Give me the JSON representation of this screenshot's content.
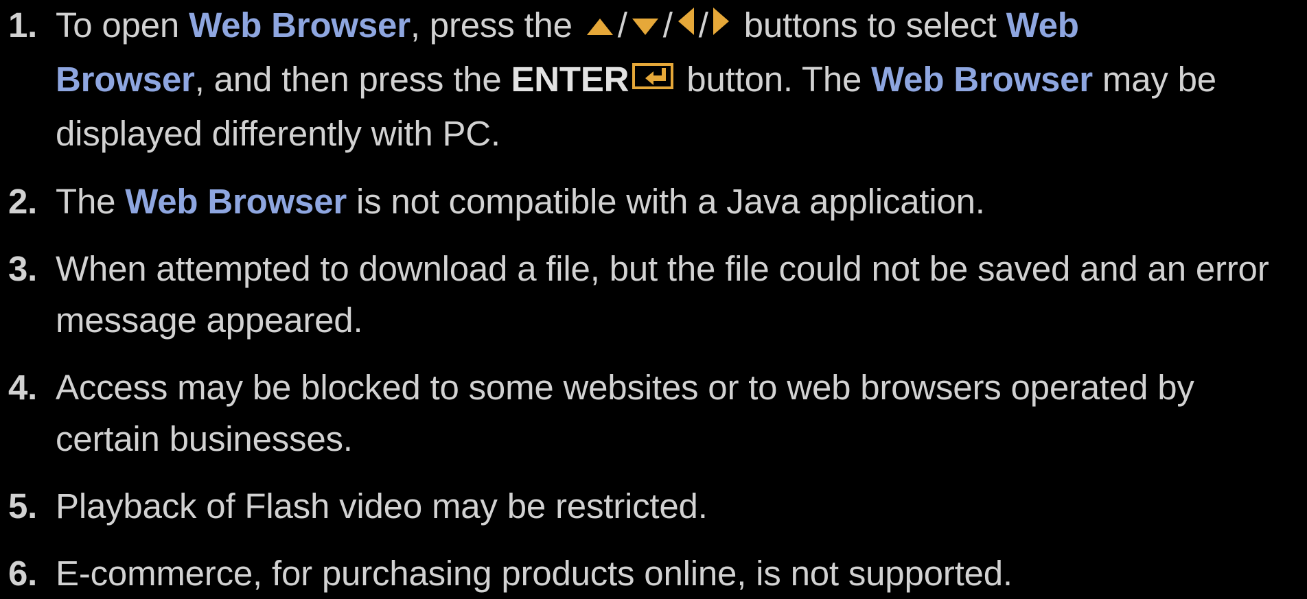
{
  "colors": {
    "background": "#000000",
    "text": "#d2d2d2",
    "highlight": "#8ea6e0",
    "icon": "#e6a839"
  },
  "items": [
    {
      "number": "1.",
      "lines": [
        {
          "segments": {
            "a": "To open ",
            "b": "Web Browser",
            "c": ", press the ",
            "sep1": "/",
            "sep2": "/",
            "sep3": "/",
            "d": " buttons to select ",
            "e": "Web"
          }
        },
        {
          "segments": {
            "a": "Browser",
            "b": ", and then press the ",
            "c": "ENTER",
            "d": " button. The ",
            "e": "Web Browser",
            "f": " may be"
          }
        },
        {
          "text": "displayed differently with PC."
        }
      ],
      "icons": [
        "up-arrow-icon",
        "down-arrow-icon",
        "left-arrow-icon",
        "right-arrow-icon",
        "enter-icon"
      ]
    },
    {
      "number": "2.",
      "segments": {
        "a": "The ",
        "b": "Web Browser",
        "c": " is not compatible with a Java application."
      }
    },
    {
      "number": "3.",
      "lines": [
        {
          "text": "When attempted to download a file, but the file could not be saved and an error"
        },
        {
          "text": "message appeared."
        }
      ]
    },
    {
      "number": "4.",
      "lines": [
        {
          "text": "Access may be blocked to some websites or to web browsers operated by"
        },
        {
          "text": "certain businesses."
        }
      ]
    },
    {
      "number": "5.",
      "text": "Playback of Flash video may be restricted."
    },
    {
      "number": "6.",
      "text": "E-commerce, for purchasing products online, is not supported."
    }
  ]
}
